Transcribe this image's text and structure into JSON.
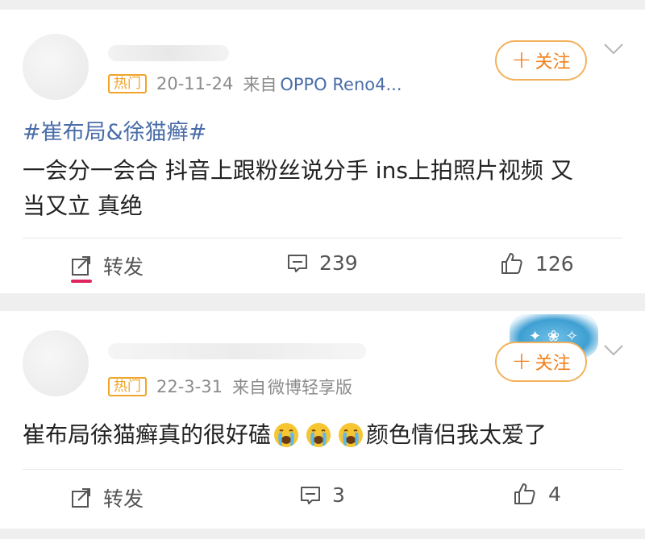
{
  "posts": [
    {
      "badge": "热门",
      "date": "20-11-24",
      "source_prefix": "来自",
      "source_name": "OPPO Reno4...",
      "follow_label": "关注",
      "hashtag": "#崔布局&徐猫癣#",
      "text_line1": "一会分一会合 抖音上跟粉丝说分手 ins上拍照片视频 又",
      "text_line2": "当又立 真绝",
      "repost_label": "转发",
      "comment_count": "239",
      "like_count": "126"
    },
    {
      "badge": "热门",
      "date": "22-3-31",
      "source_prefix": "来自",
      "source_name": "微博轻享版",
      "follow_label": "关注",
      "text_before": "崔布局徐猫癣真的很好磕",
      "emojis": [
        "crying-face",
        "crying-face",
        "crying-face"
      ],
      "text_after": "颜色情侣我太爱了",
      "repost_label": "转发",
      "comment_count": "3",
      "like_count": "4"
    }
  ],
  "colors": {
    "accent_orange": "#f07f18",
    "badge_orange": "#f0a42a",
    "link_blue": "#4a6da8",
    "active_pink": "#e0245e"
  }
}
